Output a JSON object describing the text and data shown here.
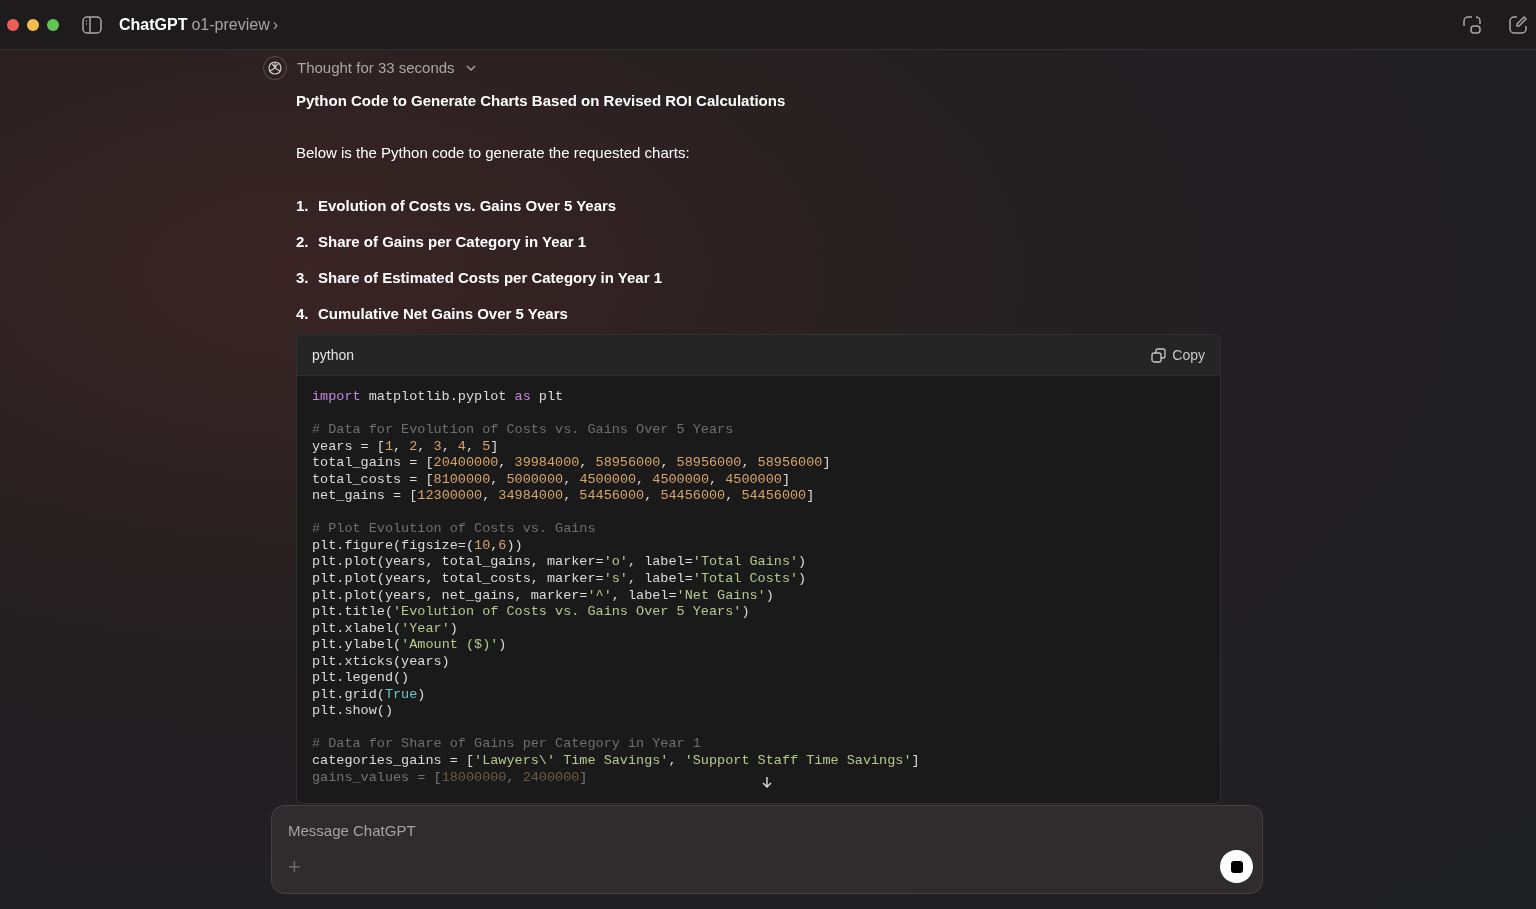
{
  "window": {
    "title": "ChatGPT",
    "model": "o1-preview",
    "model_chevron": "›"
  },
  "thought": {
    "label": "Thought for 33 seconds",
    "expanded": false
  },
  "heading": "Python Code to Generate Charts Based on Revised ROI Calculations",
  "intro": "Below is the Python code to generate the requested charts:",
  "list": [
    {
      "number": "1.",
      "text": "Evolution of Costs vs. Gains Over 5 Years"
    },
    {
      "number": "2.",
      "text": "Share of Gains per Category in Year 1"
    },
    {
      "number": "3.",
      "text": "Share of Estimated Costs per Category in Year 1"
    },
    {
      "number": "4.",
      "text": "Cumulative Net Gains Over 5 Years"
    }
  ],
  "code_block": {
    "language": "python",
    "copy_label": "Copy",
    "lines": [
      {
        "kind": "code",
        "faded": false,
        "tokens": [
          {
            "kind": "keyword",
            "text": "import"
          },
          {
            "kind": "plain",
            "text": " matplotlib.pyplot "
          },
          {
            "kind": "keyword",
            "text": "as"
          },
          {
            "kind": "plain",
            "text": " plt"
          }
        ]
      },
      {
        "kind": "blank"
      },
      {
        "kind": "code",
        "faded": false,
        "tokens": [
          {
            "kind": "comment",
            "text": "# Data for Evolution of Costs vs. Gains Over 5 Years"
          }
        ]
      },
      {
        "kind": "code",
        "faded": false,
        "tokens": [
          {
            "kind": "plain",
            "text": "years = ["
          },
          {
            "kind": "number",
            "text": "1"
          },
          {
            "kind": "plain",
            "text": ", "
          },
          {
            "kind": "number",
            "text": "2"
          },
          {
            "kind": "plain",
            "text": ", "
          },
          {
            "kind": "number",
            "text": "3"
          },
          {
            "kind": "plain",
            "text": ", "
          },
          {
            "kind": "number",
            "text": "4"
          },
          {
            "kind": "plain",
            "text": ", "
          },
          {
            "kind": "number",
            "text": "5"
          },
          {
            "kind": "plain",
            "text": "]"
          }
        ]
      },
      {
        "kind": "code",
        "faded": false,
        "tokens": [
          {
            "kind": "plain",
            "text": "total_gains = ["
          },
          {
            "kind": "number",
            "text": "20400000"
          },
          {
            "kind": "plain",
            "text": ", "
          },
          {
            "kind": "number",
            "text": "39984000"
          },
          {
            "kind": "plain",
            "text": ", "
          },
          {
            "kind": "number",
            "text": "58956000"
          },
          {
            "kind": "plain",
            "text": ", "
          },
          {
            "kind": "number",
            "text": "58956000"
          },
          {
            "kind": "plain",
            "text": ", "
          },
          {
            "kind": "number",
            "text": "58956000"
          },
          {
            "kind": "plain",
            "text": "]"
          }
        ]
      },
      {
        "kind": "code",
        "faded": false,
        "tokens": [
          {
            "kind": "plain",
            "text": "total_costs = ["
          },
          {
            "kind": "number",
            "text": "8100000"
          },
          {
            "kind": "plain",
            "text": ", "
          },
          {
            "kind": "number",
            "text": "5000000"
          },
          {
            "kind": "plain",
            "text": ", "
          },
          {
            "kind": "number",
            "text": "4500000"
          },
          {
            "kind": "plain",
            "text": ", "
          },
          {
            "kind": "number",
            "text": "4500000"
          },
          {
            "kind": "plain",
            "text": ", "
          },
          {
            "kind": "number",
            "text": "4500000"
          },
          {
            "kind": "plain",
            "text": "]"
          }
        ]
      },
      {
        "kind": "code",
        "faded": false,
        "tokens": [
          {
            "kind": "plain",
            "text": "net_gains = ["
          },
          {
            "kind": "number",
            "text": "12300000"
          },
          {
            "kind": "plain",
            "text": ", "
          },
          {
            "kind": "number",
            "text": "34984000"
          },
          {
            "kind": "plain",
            "text": ", "
          },
          {
            "kind": "number",
            "text": "54456000"
          },
          {
            "kind": "plain",
            "text": ", "
          },
          {
            "kind": "number",
            "text": "54456000"
          },
          {
            "kind": "plain",
            "text": ", "
          },
          {
            "kind": "number",
            "text": "54456000"
          },
          {
            "kind": "plain",
            "text": "]"
          }
        ]
      },
      {
        "kind": "blank"
      },
      {
        "kind": "code",
        "faded": false,
        "tokens": [
          {
            "kind": "comment",
            "text": "# Plot Evolution of Costs vs. Gains"
          }
        ]
      },
      {
        "kind": "code",
        "faded": false,
        "tokens": [
          {
            "kind": "plain",
            "text": "plt.figure(figsize=("
          },
          {
            "kind": "number",
            "text": "10"
          },
          {
            "kind": "plain",
            "text": ","
          },
          {
            "kind": "number",
            "text": "6"
          },
          {
            "kind": "plain",
            "text": "))"
          }
        ]
      },
      {
        "kind": "code",
        "faded": false,
        "tokens": [
          {
            "kind": "plain",
            "text": "plt.plot(years, total_gains, marker="
          },
          {
            "kind": "string",
            "text": "'o'"
          },
          {
            "kind": "plain",
            "text": ", label="
          },
          {
            "kind": "string",
            "text": "'Total Gains'"
          },
          {
            "kind": "plain",
            "text": ")"
          }
        ]
      },
      {
        "kind": "code",
        "faded": false,
        "tokens": [
          {
            "kind": "plain",
            "text": "plt.plot(years, total_costs, marker="
          },
          {
            "kind": "string",
            "text": "'s'"
          },
          {
            "kind": "plain",
            "text": ", label="
          },
          {
            "kind": "string",
            "text": "'Total Costs'"
          },
          {
            "kind": "plain",
            "text": ")"
          }
        ]
      },
      {
        "kind": "code",
        "faded": false,
        "tokens": [
          {
            "kind": "plain",
            "text": "plt.plot(years, net_gains, marker="
          },
          {
            "kind": "string",
            "text": "'^'"
          },
          {
            "kind": "plain",
            "text": ", label="
          },
          {
            "kind": "string",
            "text": "'Net Gains'"
          },
          {
            "kind": "plain",
            "text": ")"
          }
        ]
      },
      {
        "kind": "code",
        "faded": false,
        "tokens": [
          {
            "kind": "plain",
            "text": "plt.title("
          },
          {
            "kind": "string",
            "text": "'Evolution of Costs vs. Gains Over 5 Years'"
          },
          {
            "kind": "plain",
            "text": ")"
          }
        ]
      },
      {
        "kind": "code",
        "faded": false,
        "tokens": [
          {
            "kind": "plain",
            "text": "plt.xlabel("
          },
          {
            "kind": "string",
            "text": "'Year'"
          },
          {
            "kind": "plain",
            "text": ")"
          }
        ]
      },
      {
        "kind": "code",
        "faded": false,
        "tokens": [
          {
            "kind": "plain",
            "text": "plt.ylabel("
          },
          {
            "kind": "string",
            "text": "'Amount ($)'"
          },
          {
            "kind": "plain",
            "text": ")"
          }
        ]
      },
      {
        "kind": "code",
        "faded": false,
        "tokens": [
          {
            "kind": "plain",
            "text": "plt.xticks(years)"
          }
        ]
      },
      {
        "kind": "code",
        "faded": false,
        "tokens": [
          {
            "kind": "plain",
            "text": "plt.legend()"
          }
        ]
      },
      {
        "kind": "code",
        "faded": false,
        "tokens": [
          {
            "kind": "plain",
            "text": "plt.grid("
          },
          {
            "kind": "builtin",
            "text": "True"
          },
          {
            "kind": "plain",
            "text": ")"
          }
        ]
      },
      {
        "kind": "code",
        "faded": false,
        "tokens": [
          {
            "kind": "plain",
            "text": "plt.show()"
          }
        ]
      },
      {
        "kind": "blank"
      },
      {
        "kind": "code",
        "faded": false,
        "tokens": [
          {
            "kind": "comment",
            "text": "# Data for Share of Gains per Category in Year 1"
          }
        ]
      },
      {
        "kind": "code",
        "faded": false,
        "tokens": [
          {
            "kind": "plain",
            "text": "categories_gains = ["
          },
          {
            "kind": "string",
            "text": "'Lawyers\\' Time Savings'"
          },
          {
            "kind": "plain",
            "text": ", "
          },
          {
            "kind": "string",
            "text": "'Support Staff Time Savings'"
          },
          {
            "kind": "plain",
            "text": "]"
          }
        ]
      },
      {
        "kind": "code",
        "faded": true,
        "tokens": [
          {
            "kind": "plain",
            "text": "gains_values = ["
          },
          {
            "kind": "number",
            "text": "18000000"
          },
          {
            "kind": "plain",
            "text": ", "
          },
          {
            "kind": "number",
            "text": "2400000"
          },
          {
            "kind": "plain",
            "text": "]"
          }
        ]
      }
    ]
  },
  "composer": {
    "placeholder": "Message ChatGPT",
    "plus": "+"
  }
}
